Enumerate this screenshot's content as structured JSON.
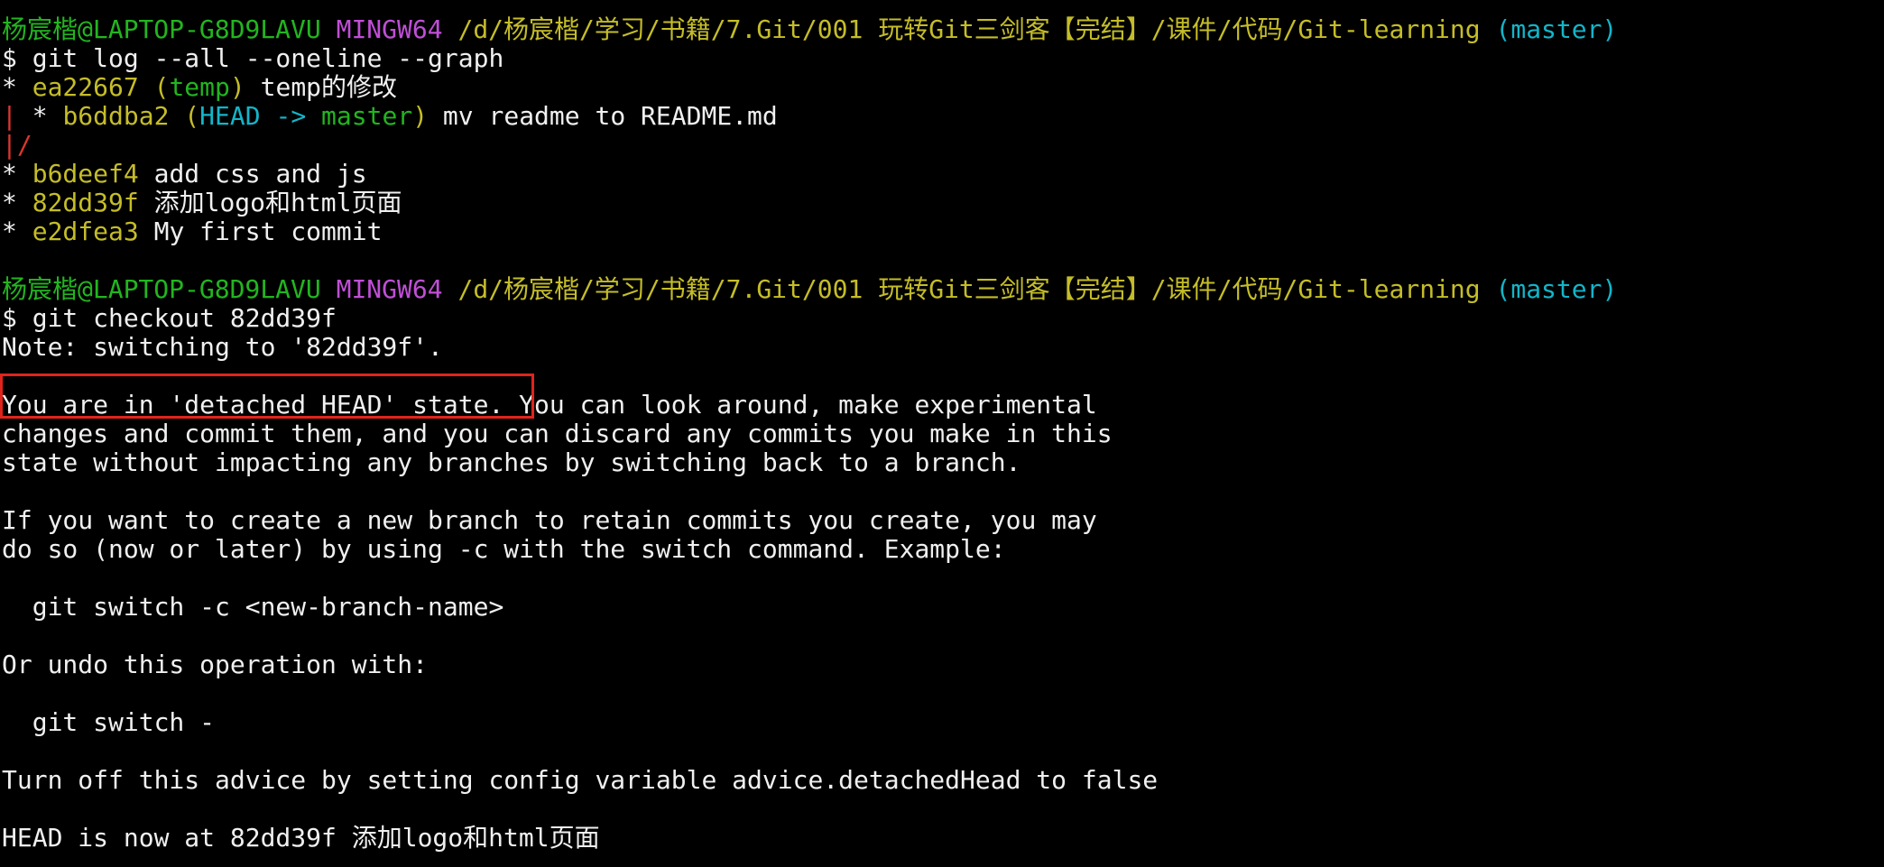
{
  "prompt1": {
    "user": "杨宸楷@LAPTOP-G8D9LAVU",
    "system": "MINGW64",
    "path": "/d/杨宸楷/学习/书籍/7.Git/001 玩转Git三剑客【完结】/课件/代码/Git-learning",
    "branch": "(master)"
  },
  "command1": "$ git log --all --oneline --graph",
  "log": [
    {
      "graph": "* ",
      "hash": "ea22667",
      "ref_open": " (",
      "ref": "temp",
      "ref_close": ")",
      "msg": " temp的修改"
    },
    {
      "graph_pipe": "|",
      "graph_rest": " * ",
      "hash": "b6ddba2",
      "ref_open": " (",
      "ref_head": "HEAD -> ",
      "ref_branch": "master",
      "ref_close": ")",
      "msg": " mv readme to README.md"
    },
    {
      "graph_merge": "|/"
    },
    {
      "graph": "* ",
      "hash": "b6deef4",
      "msg": " add css and js"
    },
    {
      "graph": "* ",
      "hash": "82dd39f",
      "msg": " 添加logo和html页面"
    },
    {
      "graph": "* ",
      "hash": "e2dfea3",
      "msg": " My first commit"
    }
  ],
  "prompt2": {
    "user": "杨宸楷@LAPTOP-G8D9LAVU",
    "system": "MINGW64",
    "path": "/d/杨宸楷/学习/书籍/7.Git/001 玩转Git三剑客【完结】/课件/代码/Git-learning",
    "branch": "(master)"
  },
  "command2": "$ git checkout 82dd39f",
  "output": {
    "note": "Note: switching to '82dd39f'.",
    "detached_highlight": "You are in 'detached HEAD' state.",
    "detached_rest": " You can look around, make experimental",
    "p1_l2": "changes and commit them, and you can discard any commits you make in this",
    "p1_l3": "state without impacting any branches by switching back to a branch.",
    "p2_l1": "If you want to create a new branch to retain commits you create, you may",
    "p2_l2": "do so (now or later) by using -c with the switch command. Example:",
    "example1": "  git switch -c <new-branch-name>",
    "undo": "Or undo this operation with:",
    "example2": "  git switch -",
    "advice": "Turn off this advice by setting config variable advice.detachedHead to false",
    "head_now": "HEAD is now at 82dd39f 添加logo和html页面"
  },
  "colors": {
    "background": "#000000",
    "text": "#f0f0f0",
    "user": "#22b51f",
    "system": "#c04fd6",
    "path": "#c5bd28",
    "branch": "#13b5c9",
    "graph_line": "#d9372f",
    "highlight_border": "#e0241b"
  }
}
